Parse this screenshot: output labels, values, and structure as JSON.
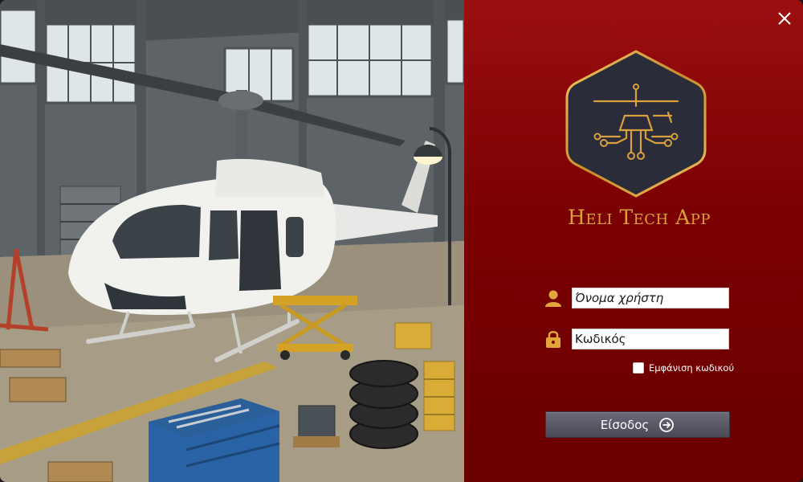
{
  "window": {
    "close_icon": "close-icon"
  },
  "brand": {
    "app_title": "Heli Tech App",
    "logo_icon": "helicopter-circuit-logo",
    "accent_color": "#d9a13c",
    "panel_color": "#7a0001"
  },
  "login": {
    "username_placeholder": "Όνομα χρήστη",
    "username_icon": "user-icon",
    "password_placeholder": "Κωδικός",
    "password_icon": "lock-icon",
    "show_password_label": "Εμφάνιση κωδικού",
    "show_password_checked": false,
    "submit_label": "Είσοδος",
    "submit_icon": "arrow-right-circle-icon"
  },
  "illustration": {
    "subject": "helicopter-in-hangar-image"
  }
}
